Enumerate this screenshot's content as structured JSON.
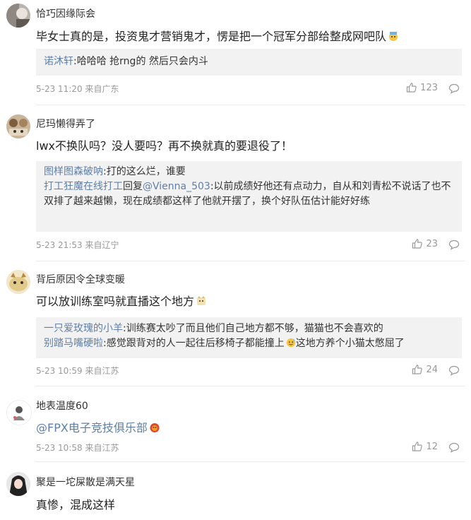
{
  "comments": [
    {
      "username": "恰巧因缘际会",
      "text": "毕女士真的是，投资鬼才营销鬼才，愣是把一个冠军分部给整成网吧队",
      "replies": [
        {
          "user": "诺沐轩",
          "sep": ":",
          "text": "哈哈哈 抢rng的 然后只会内斗"
        }
      ],
      "meta": "5-23 11:20 来自广东",
      "likes": "123"
    },
    {
      "username": "尼玛懒得弄了",
      "text": "lwx不换队吗？没人要吗？再不换就真的要退役了！",
      "replies": [
        {
          "user": "图样图森破呐",
          "sep": ":",
          "text": "打的这么烂，谁要"
        },
        {
          "user": "打工狂魔在线打工",
          "mid": "回复",
          "user2": "@Vienna_503",
          "sep": ":",
          "text": "以前成绩好他还有点动力，自从和刘青松不说话了也不双排了越来越懒，现在成绩都这样了他就开摆了，换个好队伍估计能好好练"
        }
      ],
      "meta": "5-23 21:53 来自辽宁",
      "likes": "23"
    },
    {
      "username": "背后原因令全球变暖",
      "text": "可以放训练室吗就直播这个地方",
      "replies": [
        {
          "user": "一只爱玫瑰的小羊",
          "sep": ":",
          "text": "训练赛太吵了而且他们自己地方都不够，猫猫也不会喜欢的"
        },
        {
          "user": "别踏马嘴硬啦",
          "sep": ":",
          "text": "感觉跟背对的人一起往后移椅子都能撞上",
          "text2": "这地方养个小猫太憋屈了"
        }
      ],
      "meta": "5-23 10:59 来自江苏",
      "likes": "24"
    },
    {
      "username": "地表温度60",
      "text": "@FPX电子竞技俱乐部",
      "meta": "5-23 10:58 来自江苏",
      "likes": "12"
    },
    {
      "username": "聚是一坨屎散是满天星",
      "text": "真惨，混成这样"
    }
  ],
  "icons": {
    "like": "thumbs-up-icon",
    "comment": "comment-bubble-icon"
  },
  "colors": {
    "reply_name": "#5d7fa8",
    "reply_bg": "#f2f2f2",
    "meta": "#999999"
  }
}
